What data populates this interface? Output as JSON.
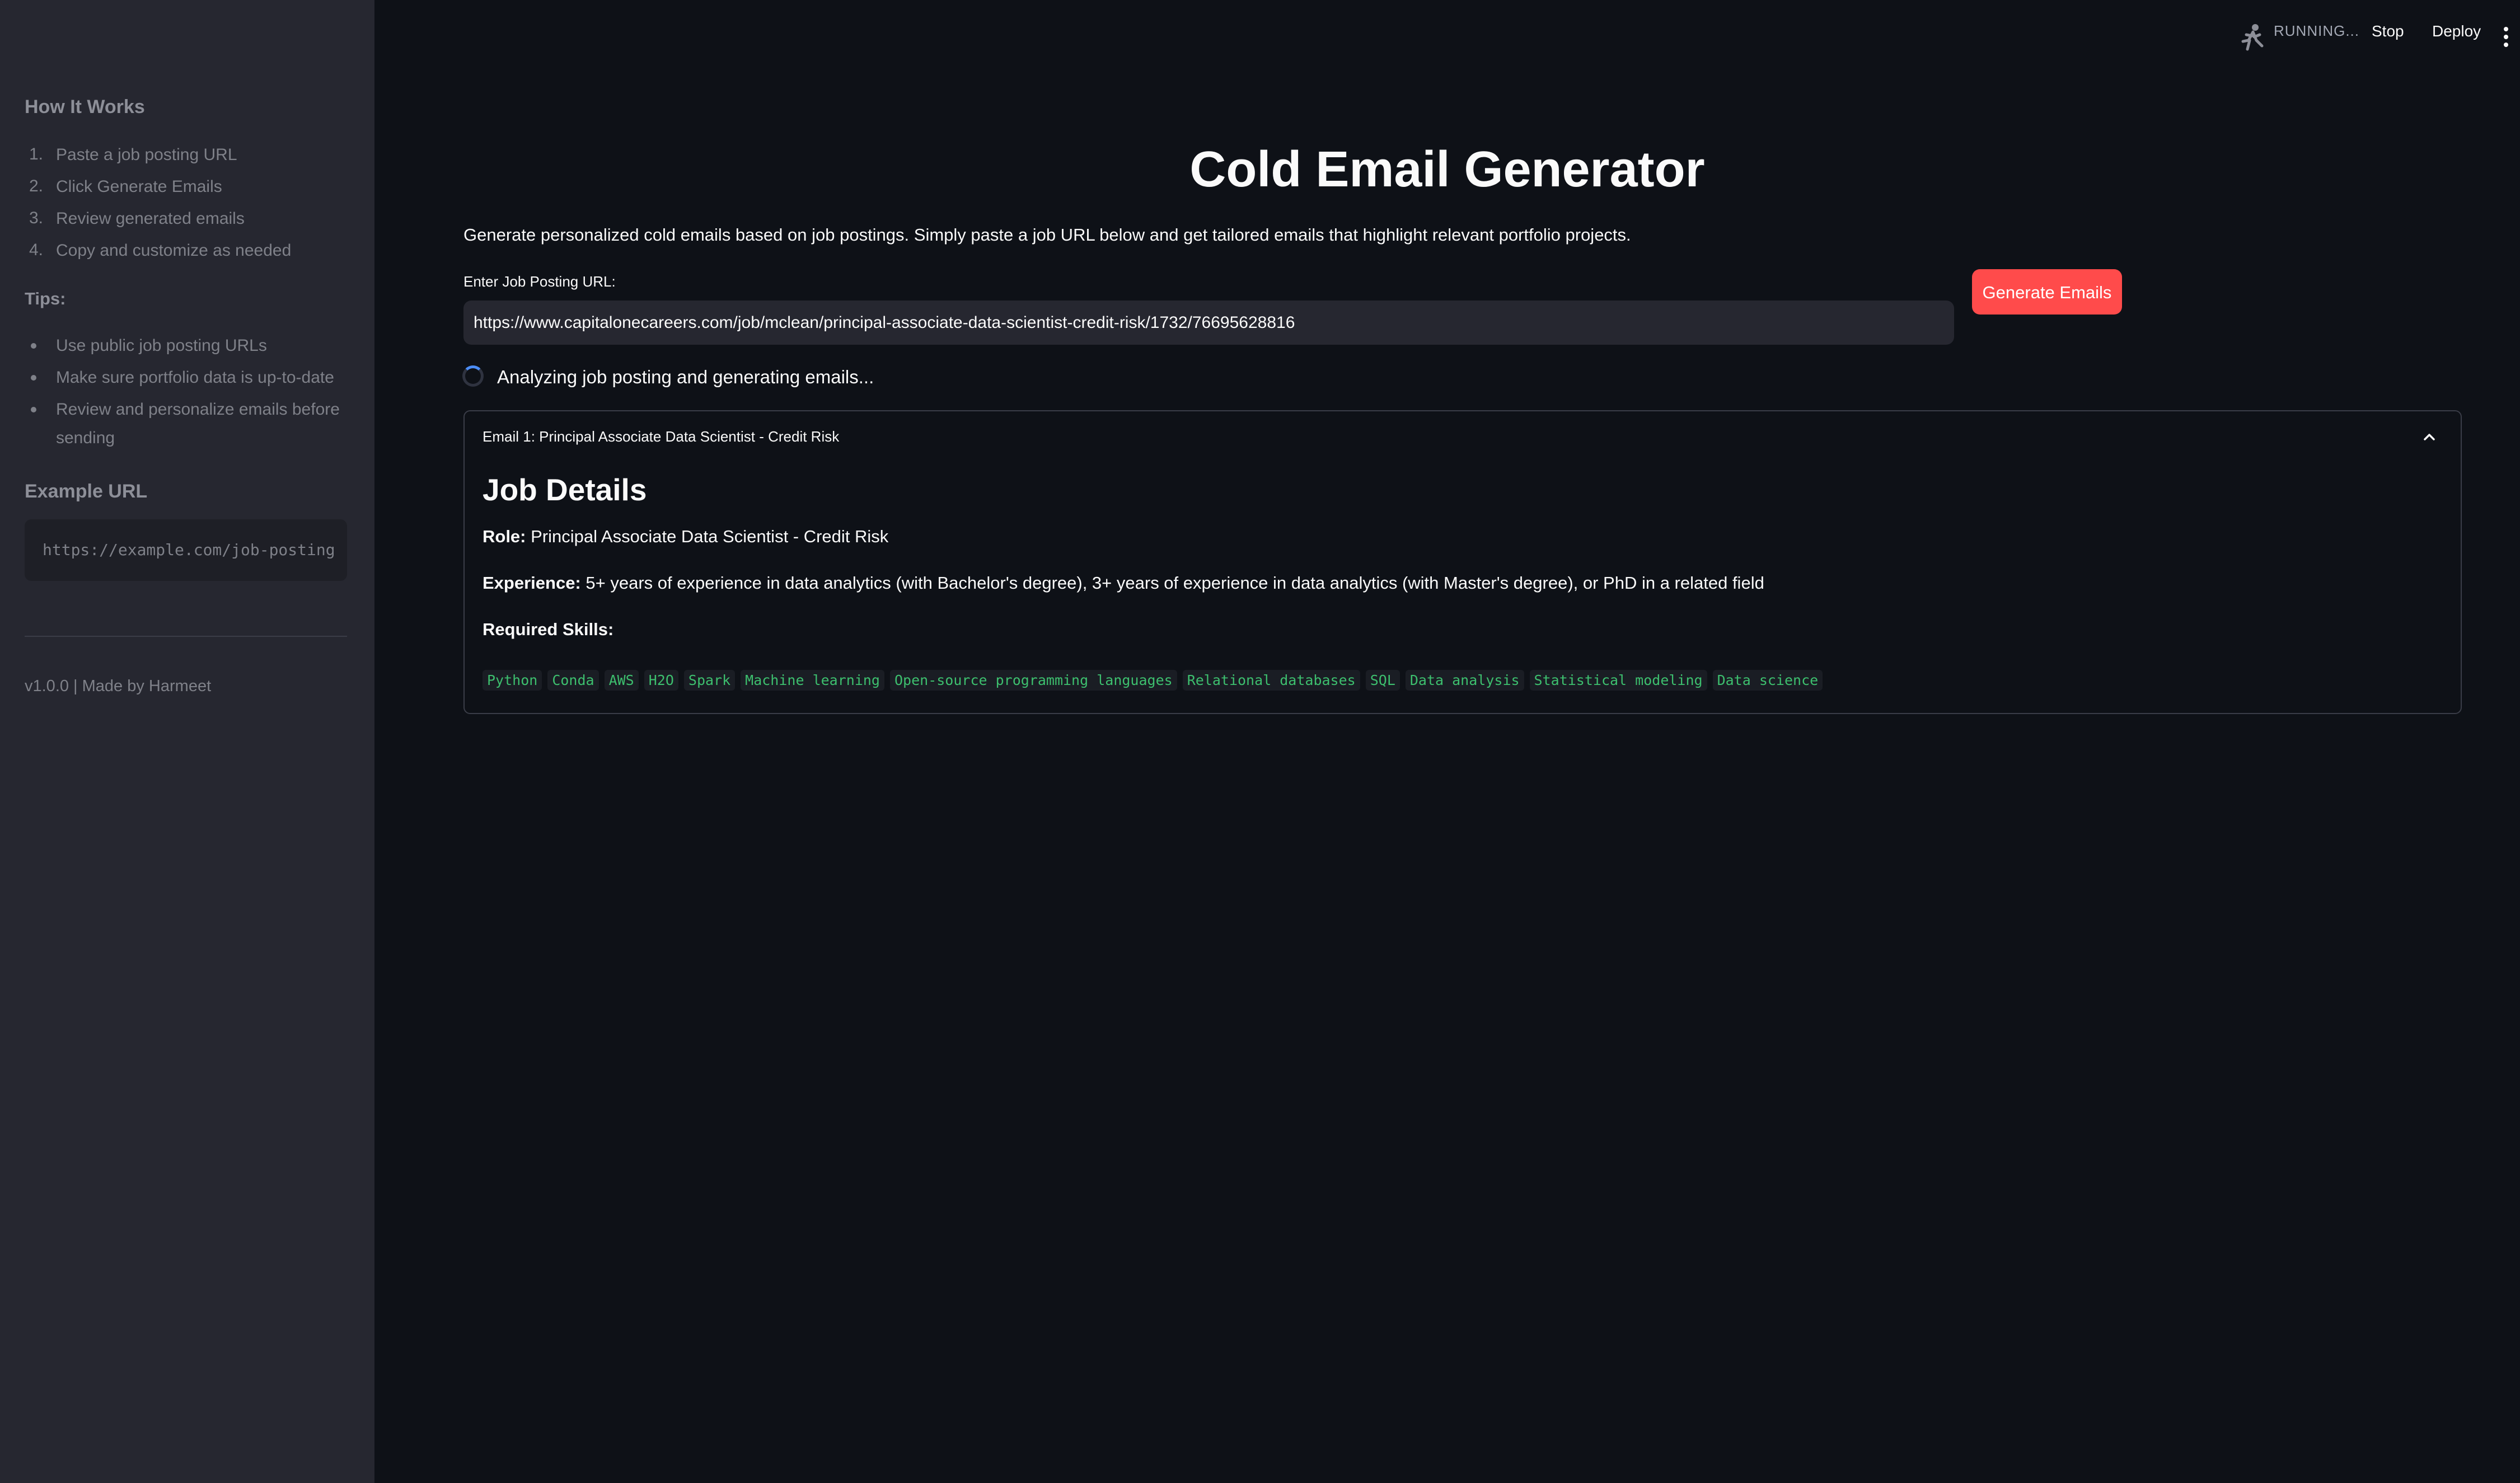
{
  "sidebar": {
    "how_title": "How It Works",
    "steps": [
      {
        "num": "1.",
        "text": "Paste a job posting URL"
      },
      {
        "num": "2.",
        "text": "Click Generate Emails"
      },
      {
        "num": "3.",
        "text": "Review generated emails"
      },
      {
        "num": "4.",
        "text": "Copy and customize as needed"
      }
    ],
    "tips_title": "Tips:",
    "tips": [
      "Use public job posting URLs",
      "Make sure portfolio data is up-to-date",
      "Review and personalize emails before",
      "sending"
    ],
    "example_title": "Example URL",
    "example_url": "https://example.com/job-posting",
    "footer": "v1.0.0 | Made by Harmeet"
  },
  "header": {
    "status": "RUNNING...",
    "stop": "Stop",
    "deploy": "Deploy",
    "menu_icon": "vertical-ellipsis-icon",
    "running_icon": "running-man-icon"
  },
  "main": {
    "title": "Cold Email Generator",
    "description": "Generate personalized cold emails based on job postings. Simply paste a job URL below and get tailored emails that highlight relevant portfolio projects.",
    "url_label": "Enter Job Posting URL:",
    "url_value": "https://www.capitalonecareers.com/job/mclean/principal-associate-data-scientist-credit-risk/1732/76695628816",
    "generate_button": "Generate Emails",
    "spinner_text": "Analyzing job posting and generating emails..."
  },
  "email": {
    "header": "Email 1: Principal Associate Data Scientist - Credit Risk",
    "section_title": "Job Details",
    "role_label": "Role:",
    "role_value": "Principal Associate Data Scientist - Credit Risk",
    "experience_label": "Experience:",
    "experience_value": "5+ years of experience in data analytics (with Bachelor's degree), 3+ years of experience in data analytics (with Master's degree), or PhD in a related field",
    "skills_label": "Required Skills:",
    "skills": [
      "Python",
      "Conda",
      "AWS",
      "H2O",
      "Spark",
      "Machine learning",
      "Open-source programming languages",
      "Relational databases",
      "SQL",
      "Data analysis",
      "Statistical modeling",
      "Data science"
    ]
  },
  "colors": {
    "background": "#0e1117",
    "sidebar": "#262730",
    "accent": "#ff4b4b",
    "skill_text": "#3dbf6e"
  }
}
